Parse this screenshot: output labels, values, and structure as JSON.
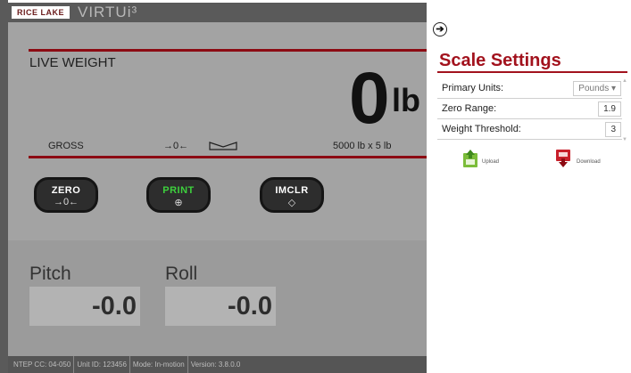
{
  "header": {
    "brand": "RICE LAKE",
    "product": "VIRTUi³"
  },
  "weight_panel": {
    "live_label": "LIVE WEIGHT",
    "value": "0",
    "unit": "lb",
    "mode": "GROSS",
    "zero_indicator": "→0←",
    "capacity": "5000 lb x 5 lb"
  },
  "buttons": [
    {
      "label": "ZERO",
      "symbol": "→0←"
    },
    {
      "label": "PRINT",
      "symbol": "⊕"
    },
    {
      "label": "IMCLR",
      "symbol": "◇"
    }
  ],
  "readouts": {
    "pitch": {
      "label": "Pitch",
      "value": "-0.0"
    },
    "roll": {
      "label": "Roll",
      "value": "-0.0"
    }
  },
  "footer": {
    "items": [
      "NTEP CC: 04-050",
      "Unit ID: 123456",
      "Mode: In-motion",
      "Version: 3.8.0.0"
    ]
  },
  "settings_panel": {
    "collapse_icon": "arrow-right-icon",
    "title": "Scale Settings",
    "rows": [
      {
        "label": "Primary Units:",
        "value": "Pounds ▾"
      },
      {
        "label": "Zero Range:",
        "value": "1.9"
      },
      {
        "label": "Weight Threshold:",
        "value": "3"
      }
    ],
    "upload_label": "Upload",
    "download_label": "Download"
  },
  "colors": {
    "accent_red": "#a2121d",
    "print_green": "#3dd03d",
    "overlay_gray": "#a3a3a3"
  }
}
